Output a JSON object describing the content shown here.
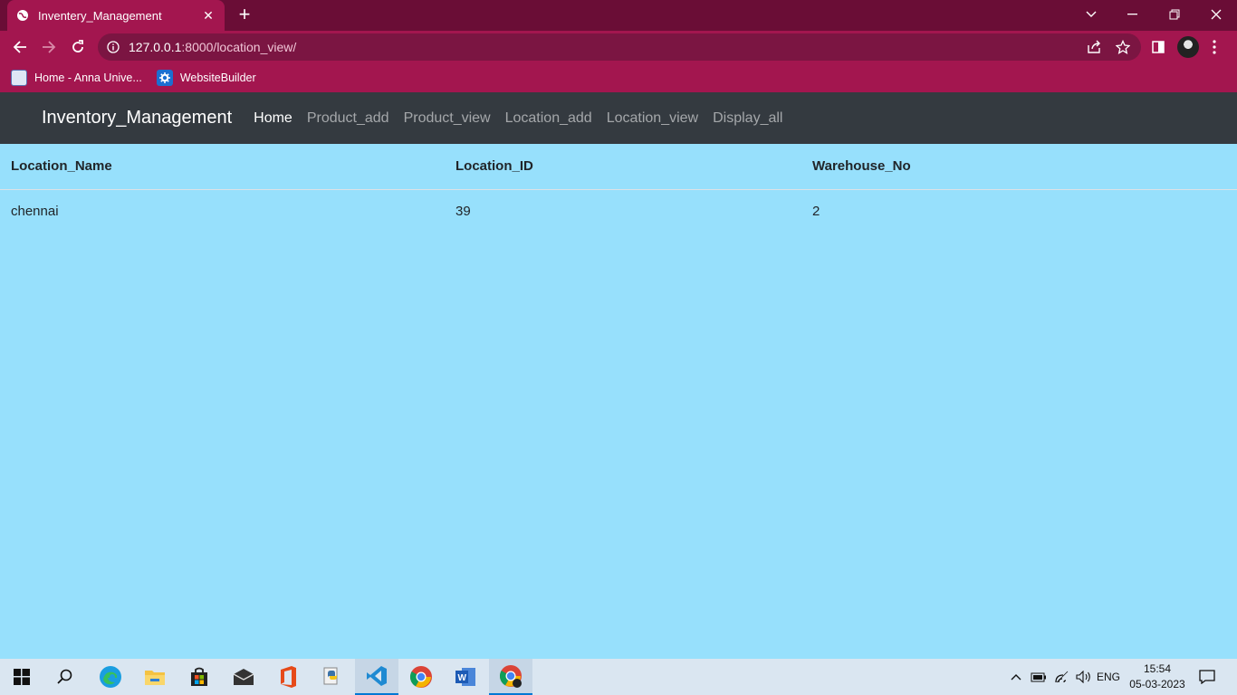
{
  "browser": {
    "tab_title": "Inventery_Management",
    "new_tab_icon": "plus-icon",
    "url_host": "127.0.0.1",
    "url_path": ":8000/location_view/",
    "bookmarks": [
      {
        "label": "Home - Anna Unive...",
        "icon": "anna-univ-icon"
      },
      {
        "label": "WebsiteBuilder",
        "icon": "gear-icon"
      }
    ]
  },
  "app": {
    "brand": "Inventory_Management",
    "nav": [
      {
        "label": "Home",
        "active": true
      },
      {
        "label": "Product_add",
        "active": false
      },
      {
        "label": "Product_view",
        "active": false
      },
      {
        "label": "Location_add",
        "active": false
      },
      {
        "label": "Location_view",
        "active": false
      },
      {
        "label": "Display_all",
        "active": false
      }
    ]
  },
  "table": {
    "headers": [
      "Location_Name",
      "Location_ID",
      "Warehouse_No"
    ],
    "rows": [
      [
        "chennai",
        "39",
        "2"
      ]
    ]
  },
  "taskbar": {
    "language": "ENG",
    "time": "15:54",
    "date": "05-03-2023"
  },
  "colors": {
    "browser_frame": "#6a0d36",
    "browser_toolbar": "#a3164f",
    "app_navbar": "#343a40",
    "page_background": "#97e0fc"
  }
}
